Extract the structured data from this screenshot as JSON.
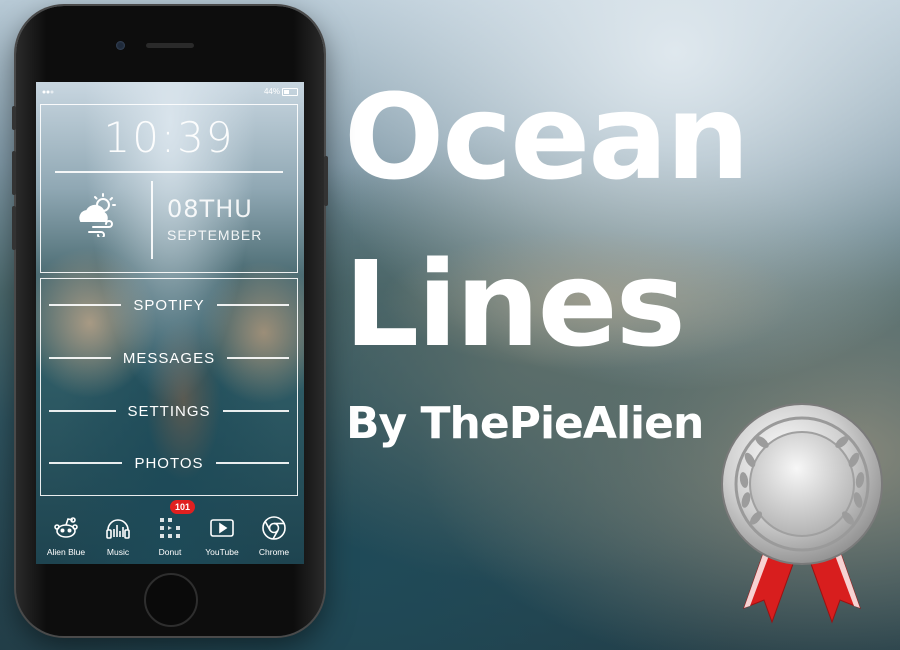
{
  "headline": {
    "line1": "Ocean",
    "line2": "Lines",
    "byline": "By ThePieAlien"
  },
  "status_bar": {
    "battery": "44%"
  },
  "widget": {
    "time": "10:39",
    "date": "08THU",
    "month": "SEPTEMBER"
  },
  "menu": {
    "items": [
      "SPOTIFY",
      "MESSAGES",
      "SETTINGS",
      "PHOTOS"
    ]
  },
  "dock": {
    "apps": [
      {
        "label": "Alien Blue",
        "icon": "reddit-alien-icon"
      },
      {
        "label": "Music",
        "icon": "music-equalizer-icon"
      },
      {
        "label": "Donut",
        "icon": "donut-grid-icon",
        "badge": "101"
      },
      {
        "label": "YouTube",
        "icon": "youtube-play-icon"
      },
      {
        "label": "Chrome",
        "icon": "chrome-icon"
      }
    ]
  },
  "colors": {
    "badge": "#e02020",
    "ribbon": "#d81e1e",
    "medal": "#c8c8c8"
  }
}
